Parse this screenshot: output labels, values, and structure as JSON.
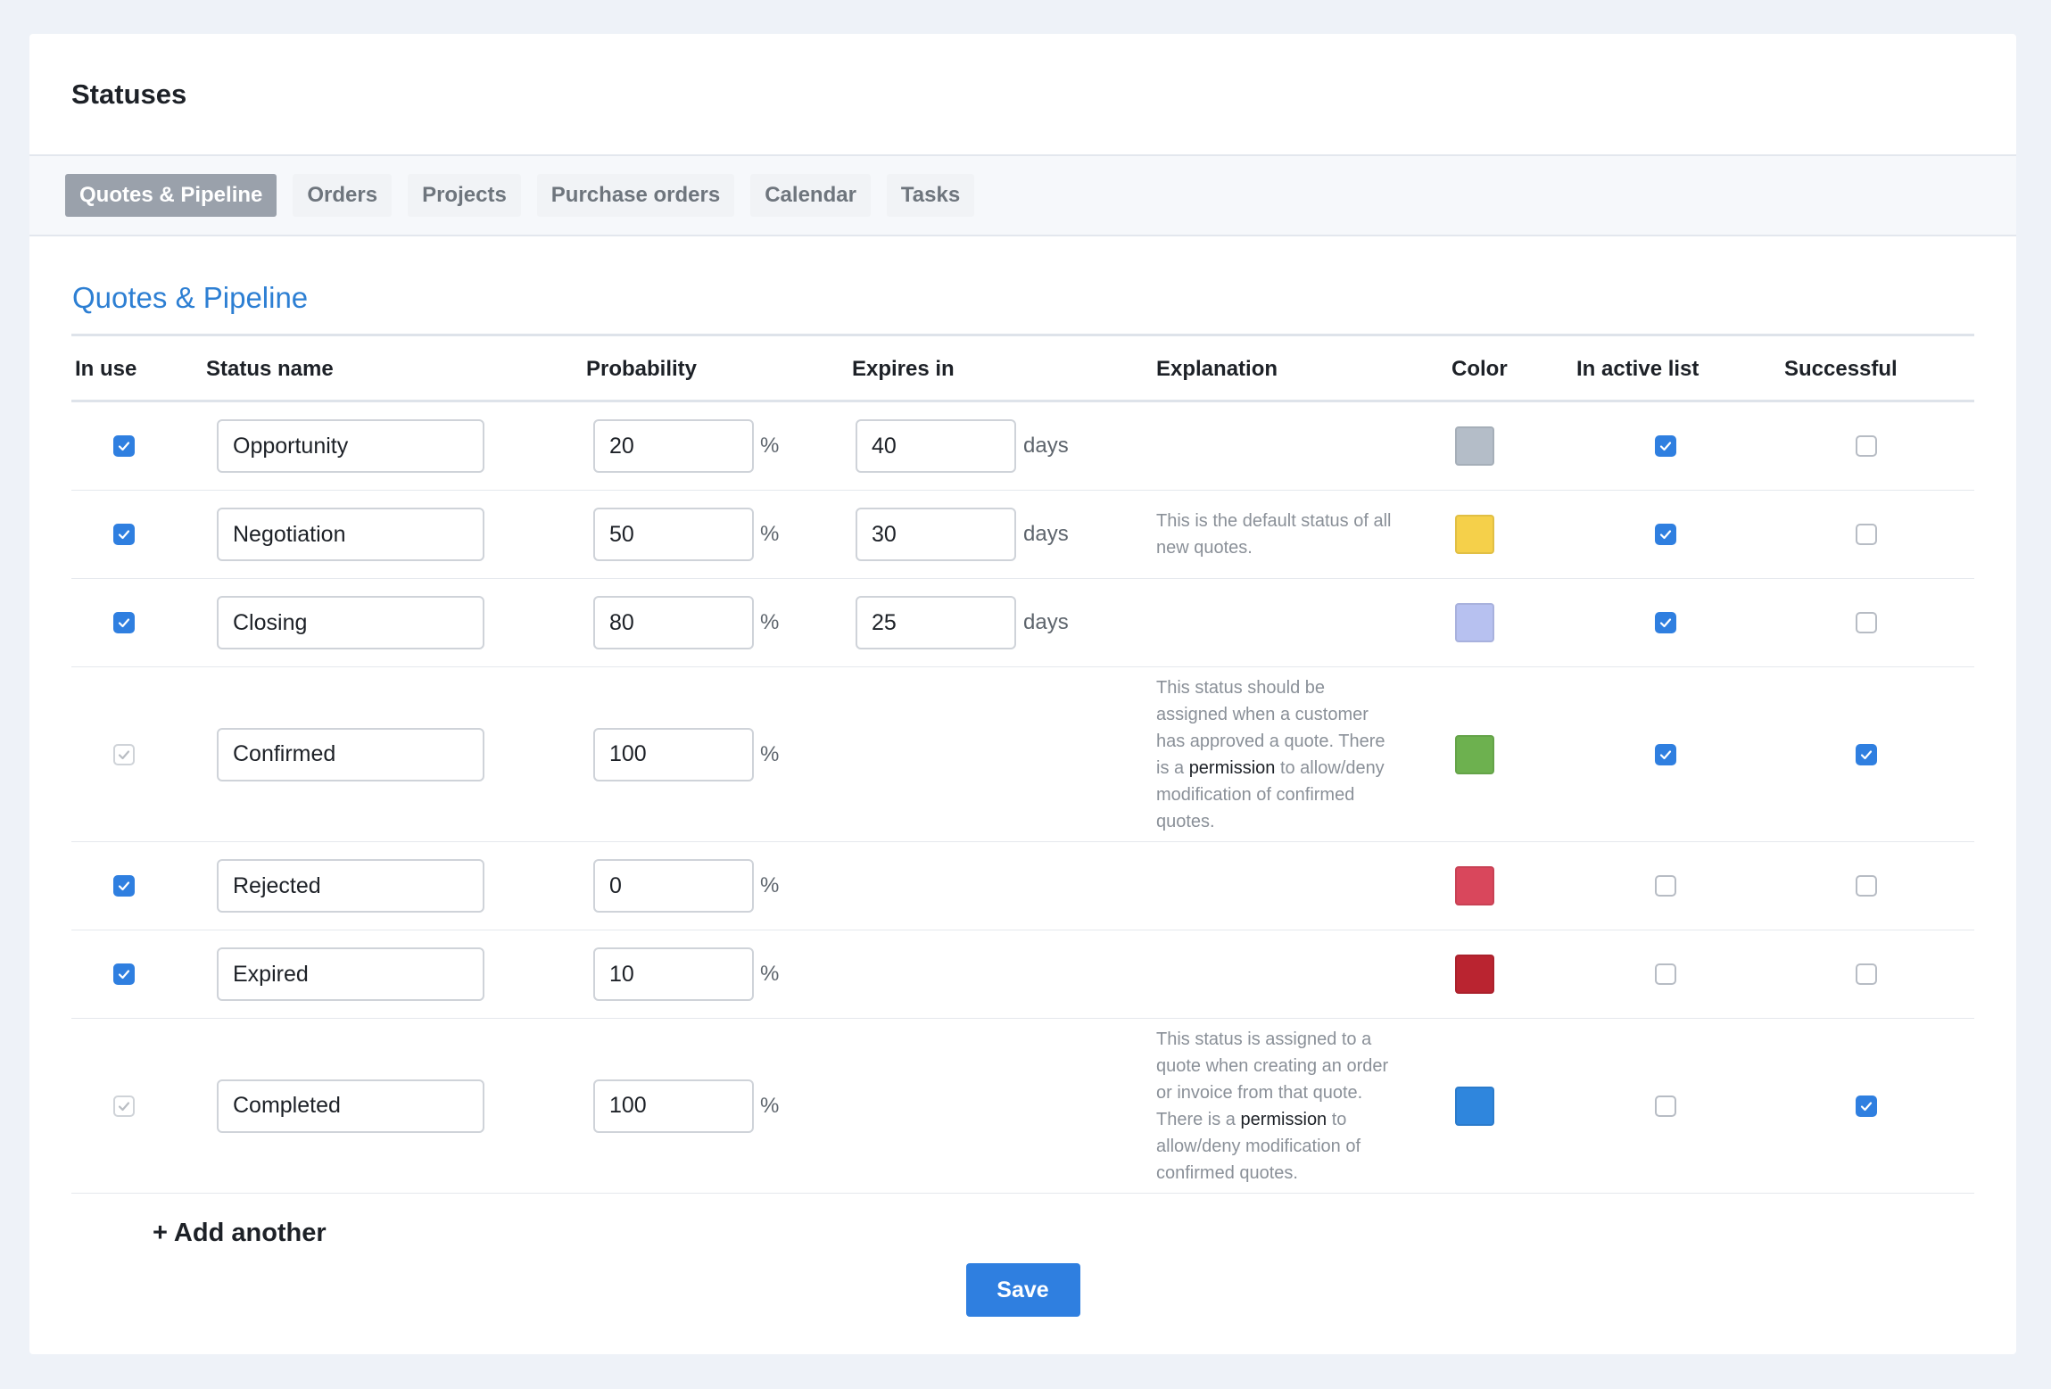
{
  "page": {
    "title": "Statuses"
  },
  "tabs": [
    {
      "label": "Quotes & Pipeline",
      "active": true
    },
    {
      "label": "Orders",
      "active": false
    },
    {
      "label": "Projects",
      "active": false
    },
    {
      "label": "Purchase orders",
      "active": false
    },
    {
      "label": "Calendar",
      "active": false
    },
    {
      "label": "Tasks",
      "active": false
    }
  ],
  "section": {
    "title": "Quotes & Pipeline"
  },
  "table": {
    "headers": {
      "in_use": "In use",
      "status_name": "Status name",
      "probability": "Probability",
      "expires_in": "Expires in",
      "explanation": "Explanation",
      "color": "Color",
      "in_active_list": "In active list",
      "successful": "Successful"
    },
    "percent_unit": "%",
    "days_unit": "days",
    "rows": [
      {
        "in_use": true,
        "in_use_disabled": false,
        "name": "Opportunity",
        "probability": "20",
        "expires_in": "40",
        "explanation": [],
        "color": "#b4bdc8",
        "in_active_list": true,
        "successful": false
      },
      {
        "in_use": true,
        "in_use_disabled": false,
        "name": "Negotiation",
        "probability": "50",
        "expires_in": "30",
        "explanation": [
          "This is the default status of all",
          "new quotes."
        ],
        "color": "#f5d04a",
        "in_active_list": true,
        "successful": false
      },
      {
        "in_use": true,
        "in_use_disabled": false,
        "name": "Closing",
        "probability": "80",
        "expires_in": "25",
        "explanation": [],
        "color": "#b7c1f0",
        "in_active_list": true,
        "successful": false
      },
      {
        "in_use": true,
        "in_use_disabled": true,
        "name": "Confirmed",
        "probability": "100",
        "expires_in": null,
        "explanation": [
          "This status should be",
          "assigned when a customer",
          "has approved a quote. There",
          "is a |permission| to allow/deny",
          "modification of confirmed",
          "quotes."
        ],
        "color": "#6db14f",
        "in_active_list": true,
        "successful": true
      },
      {
        "in_use": true,
        "in_use_disabled": false,
        "name": "Rejected",
        "probability": "0",
        "expires_in": null,
        "explanation": [],
        "color": "#d9475c",
        "in_active_list": false,
        "successful": false
      },
      {
        "in_use": true,
        "in_use_disabled": false,
        "name": "Expired",
        "probability": "10",
        "expires_in": null,
        "explanation": [],
        "color": "#ba2430",
        "in_active_list": false,
        "successful": false
      },
      {
        "in_use": true,
        "in_use_disabled": true,
        "name": "Completed",
        "probability": "100",
        "expires_in": null,
        "explanation": [
          "This status is assigned to a",
          "quote when creating an order",
          "or invoice from that quote.",
          "There is a |permission| to",
          "allow/deny modification of",
          "confirmed quotes."
        ],
        "color": "#2f86dd",
        "in_active_list": false,
        "successful": true
      }
    ]
  },
  "actions": {
    "add_another": "+ Add another",
    "save": "Save"
  }
}
